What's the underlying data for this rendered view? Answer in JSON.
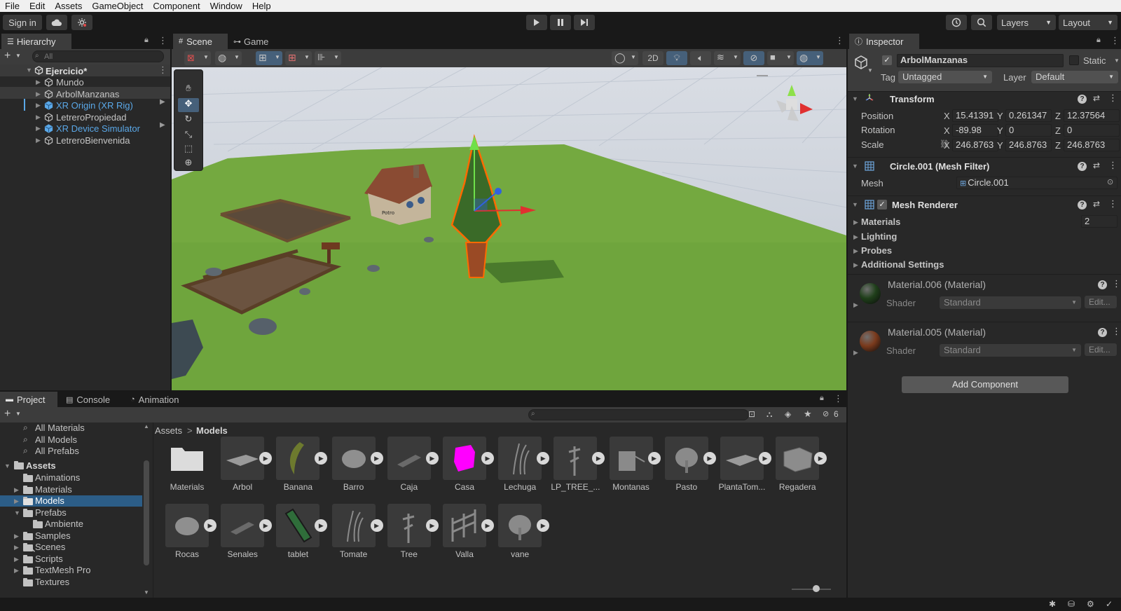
{
  "menu": [
    "File",
    "Edit",
    "Assets",
    "GameObject",
    "Component",
    "Window",
    "Help"
  ],
  "toolbar": {
    "sign_in": "Sign in",
    "layers": "Layers",
    "layout": "Layout"
  },
  "hierarchy": {
    "title": "Hierarchy",
    "search_placeholder": "All",
    "scene": "Ejercicio*",
    "items": [
      {
        "label": "Mundo",
        "color": "#c4c4c4"
      },
      {
        "label": "ArbolManzanas",
        "color": "#c4c4c4"
      },
      {
        "label": "XR Origin (XR Rig)",
        "color": "#5aa8e8"
      },
      {
        "label": "LetreroPropiedad",
        "color": "#c4c4c4"
      },
      {
        "label": "XR Device Simulator",
        "color": "#5aa8e8"
      },
      {
        "label": "LetreroBienvenida",
        "color": "#c4c4c4"
      }
    ]
  },
  "scene_tabs": {
    "scene": "Scene",
    "game": "Game"
  },
  "scene_toolbar": {
    "mode_2d": "2D"
  },
  "scene_labels": {
    "sign_text": "Potro"
  },
  "inspector": {
    "title": "Inspector",
    "object_name": "ArbolManzanas",
    "static_label": "Static",
    "tag_label": "Tag",
    "tag_value": "Untagged",
    "layer_label": "Layer",
    "layer_value": "Default",
    "transform": {
      "title": "Transform",
      "position_label": "Position",
      "rotation_label": "Rotation",
      "scale_label": "Scale",
      "position": {
        "x": "15.41391",
        "y": "0.261347",
        "z": "12.37564"
      },
      "rotation": {
        "x": "-89.98",
        "y": "0",
        "z": "0"
      },
      "scale": {
        "x": "246.8763",
        "y": "246.8763",
        "z": "246.8763"
      }
    },
    "mesh_filter": {
      "title": "Circle.001 (Mesh Filter)",
      "mesh_label": "Mesh",
      "mesh_value": "Circle.001"
    },
    "mesh_renderer": {
      "title": "Mesh Renderer",
      "materials_label": "Materials",
      "materials_count": "2",
      "lighting_label": "Lighting",
      "probes_label": "Probes",
      "additional_label": "Additional Settings"
    },
    "materials": [
      {
        "name": "Material.006 (Material)",
        "shader_label": "Shader",
        "shader": "Standard",
        "edit": "Edit...",
        "color": "#1f3f1a"
      },
      {
        "name": "Material.005 (Material)",
        "shader_label": "Shader",
        "shader": "Standard",
        "edit": "Edit...",
        "color": "#7a3a1c"
      }
    ],
    "add_component": "Add Component"
  },
  "bottom_tabs": {
    "project": "Project",
    "console": "Console",
    "animation": "Animation"
  },
  "project": {
    "favorites": [
      "All Materials",
      "All Models",
      "All Prefabs"
    ],
    "assets_root": "Assets",
    "tree": [
      {
        "label": "Animations",
        "indent": 1
      },
      {
        "label": "Materials",
        "indent": 1
      },
      {
        "label": "Models",
        "indent": 1,
        "selected": true
      },
      {
        "label": "Prefabs",
        "indent": 1,
        "open": true
      },
      {
        "label": "Ambiente",
        "indent": 2
      },
      {
        "label": "Samples",
        "indent": 1
      },
      {
        "label": "Scenes",
        "indent": 1
      },
      {
        "label": "Scripts",
        "indent": 1
      },
      {
        "label": "TextMesh Pro",
        "indent": 1
      },
      {
        "label": "Textures",
        "indent": 1
      }
    ],
    "breadcrumb": [
      "Assets",
      "Models"
    ],
    "hidden_count": "6",
    "assets_row1": [
      "Materials",
      "Arbol",
      "Banana",
      "Barro",
      "Caja",
      "Casa",
      "Lechuga",
      "LP_TREE_...",
      "Montanas",
      "Pasto",
      "PlantaTom...",
      "Regadera"
    ],
    "assets_row2": [
      "Rocas",
      "Senales",
      "tablet",
      "Tomate",
      "Tree",
      "Valla",
      "vane"
    ]
  },
  "colors": {
    "accent": "#2c5d87",
    "xr_blue": "#5aa8e8",
    "grass": "#6aa03a",
    "sky": "#c8cfd8",
    "casa_magenta": "#ff00ff"
  }
}
